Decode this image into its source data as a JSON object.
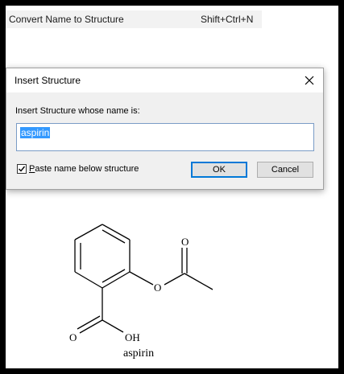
{
  "menu": {
    "item_label": "Convert Name to Structure",
    "item_shortcut": "Shift+Ctrl+N"
  },
  "dialog": {
    "title": "Insert Structure",
    "prompt": "Insert Structure whose name is:",
    "input_value": "aspirin",
    "checkbox_label_prefix": "P",
    "checkbox_label_rest": "aste name below structure",
    "checkbox_checked": true,
    "ok_label": "OK",
    "cancel_label": "Cancel"
  },
  "structure": {
    "atom_o_carbonyl_top": "O",
    "atom_o_ester": "O",
    "atom_o_acid": "O",
    "atom_oh": "OH",
    "caption": "aspirin"
  }
}
